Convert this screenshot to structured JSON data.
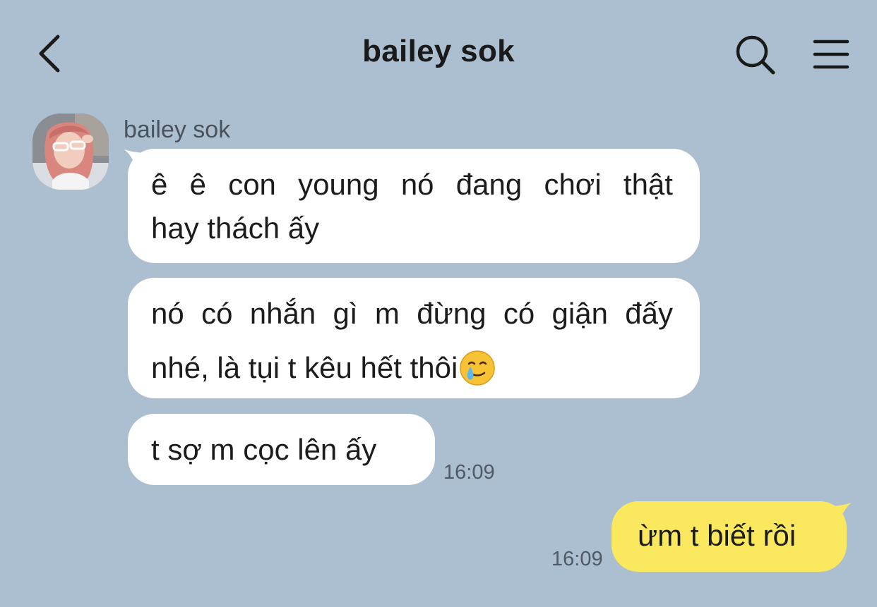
{
  "header": {
    "title": "bailey sok",
    "back_icon": "chevron-left-icon",
    "search_icon": "search-icon",
    "menu_icon": "hamburger-menu-icon"
  },
  "messages": [
    {
      "sender": "bailey sok",
      "lines": [
        "ê ê con young nó đang chơi thật",
        "hay thách ấy"
      ]
    },
    {
      "lines": [
        "nó có nhắn gì m đừng có giận đấy",
        "nhé, là tụi t kêu hết thôi"
      ],
      "emoji": "tearful-smile-emoji"
    },
    {
      "lines": [
        "t sợ m cọc lên ấy"
      ],
      "time": "16:09"
    },
    {
      "lines": [
        "ừm t biết rồi"
      ],
      "time": "16:09",
      "outgoing": true
    }
  ],
  "colors": {
    "background": "#abbfd0",
    "incoming_bubble": "#ffffff",
    "outgoing_bubble": "#fae95f",
    "text": "#1c1c1c"
  }
}
